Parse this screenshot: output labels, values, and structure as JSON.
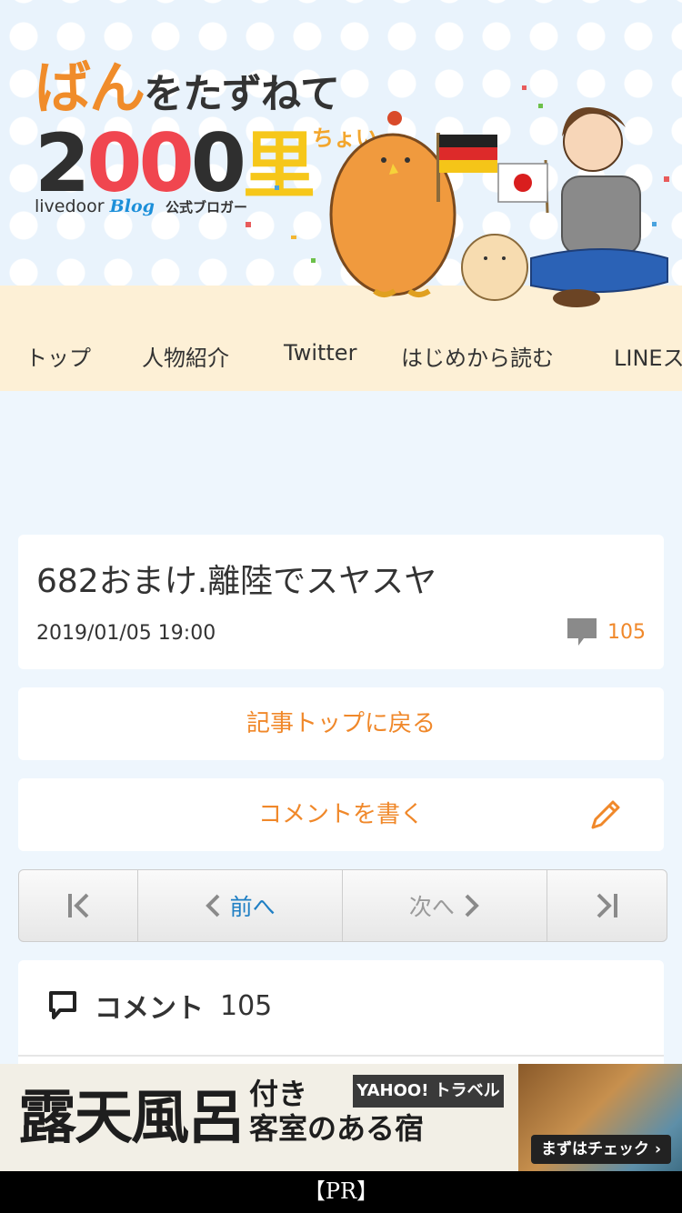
{
  "header": {
    "logo": {
      "line1_big": "ばん",
      "line1_rest": "をたずねて",
      "line2_num_dark1": "2",
      "line2_num_red": "00",
      "line2_num_dark2": "0",
      "line2_kanji": "里",
      "line2_suffix": "ちょい",
      "brand": "livedoor",
      "brand_blog": "Blog",
      "official": "公式ブロガー"
    }
  },
  "nav": {
    "items": [
      {
        "label": "トップ"
      },
      {
        "label": "人物紹介"
      },
      {
        "label": "Twitter"
      },
      {
        "label": "はじめから読む"
      },
      {
        "label": "LINEス"
      }
    ]
  },
  "article": {
    "title": "682おまけ.離陸でスヤスヤ",
    "date": "2019/01/05 19:00",
    "comment_count": "105"
  },
  "actions": {
    "back_to_top": "記事トップに戻る",
    "write_comment": "コメントを書く"
  },
  "pager": {
    "prev": "前へ",
    "next": "次へ"
  },
  "comments": {
    "heading": "コメント",
    "count": "105"
  },
  "ad": {
    "headline_big": "露天風呂",
    "headline_small_1": "付き",
    "headline_small_2": "客室のある宿",
    "brand": "YAHOO! トラベル",
    "cta": "まずはチェック ›",
    "label": "【PR】"
  },
  "colors": {
    "accent": "#f0882a",
    "link_blue": "#1f7fc4",
    "page_bg": "#eef6fd",
    "nav_bg": "#fdf0d6"
  },
  "icons": [
    "comment-bubble-icon",
    "pencil-icon",
    "first-page-icon",
    "chevron-left-icon",
    "chevron-right-icon",
    "last-page-icon",
    "comments-icon"
  ]
}
